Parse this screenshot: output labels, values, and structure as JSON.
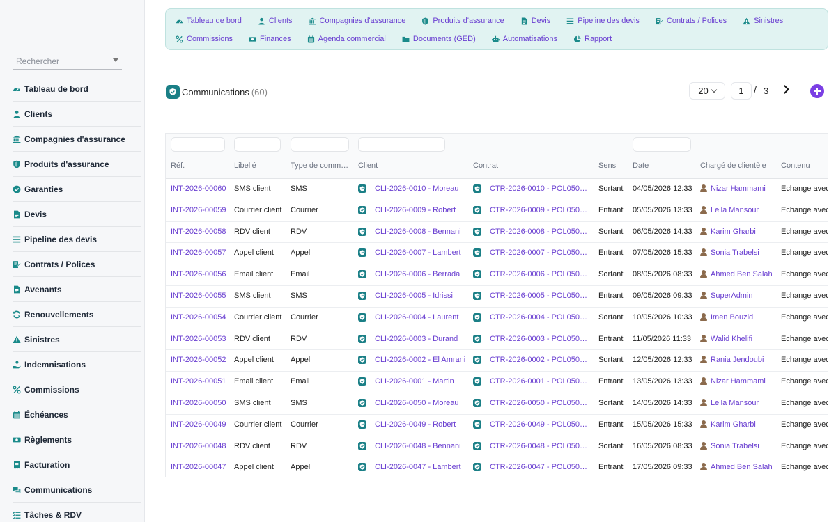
{
  "sidebar": {
    "search_placeholder": "Rechercher",
    "items": [
      {
        "label": "Tableau de bord",
        "icon": "gauge-icon"
      },
      {
        "label": "Clients",
        "icon": "user-icon"
      },
      {
        "label": "Compagnies d'assurance",
        "icon": "bank-icon"
      },
      {
        "label": "Produits d'assurance",
        "icon": "shield-icon"
      },
      {
        "label": "Garanties",
        "icon": "check-badge-icon"
      },
      {
        "label": "Devis",
        "icon": "document-icon"
      },
      {
        "label": "Pipeline des devis",
        "icon": "list-icon"
      },
      {
        "label": "Contrats / Polices",
        "icon": "contract-icon"
      },
      {
        "label": "Avenants",
        "icon": "document-icon"
      },
      {
        "label": "Renouvellements",
        "icon": "refresh-icon"
      },
      {
        "label": "Sinistres",
        "icon": "warning-icon"
      },
      {
        "label": "Indemnisations",
        "icon": "hand-coin-icon"
      },
      {
        "label": "Commissions",
        "icon": "percent-icon"
      },
      {
        "label": "Échéances",
        "icon": "calendar-icon"
      },
      {
        "label": "Règlements",
        "icon": "money-icon"
      },
      {
        "label": "Facturation",
        "icon": "invoice-icon"
      },
      {
        "label": "Communications",
        "icon": "chat-icon"
      },
      {
        "label": "Tâches & RDV",
        "icon": "tasks-icon"
      }
    ]
  },
  "topnav": {
    "row1": [
      {
        "label": "Tableau de bord",
        "icon": "gauge-icon"
      },
      {
        "label": "Clients",
        "icon": "user-icon"
      },
      {
        "label": "Compagnies d'assurance",
        "icon": "bank-icon"
      },
      {
        "label": "Produits d'assurance",
        "icon": "shield-icon"
      },
      {
        "label": "Devis",
        "icon": "document-icon"
      },
      {
        "label": "Pipeline des devis",
        "icon": "list-icon"
      },
      {
        "label": "Contrats / Polices",
        "icon": "contract-icon"
      },
      {
        "label": "Sinistres",
        "icon": "warning-icon"
      }
    ],
    "row2": [
      {
        "label": "Commissions",
        "icon": "percent-icon"
      },
      {
        "label": "Finances",
        "icon": "money-icon"
      },
      {
        "label": "Agenda commercial",
        "icon": "calendar-icon"
      },
      {
        "label": "Documents (GED)",
        "icon": "folder-icon"
      },
      {
        "label": "Automatisations",
        "icon": "robot-icon"
      },
      {
        "label": "Rapport",
        "icon": "pie-icon"
      }
    ]
  },
  "header": {
    "title": "Communications",
    "count": "(60)",
    "page_size": "20",
    "current_page": "1",
    "separator": "/",
    "total_pages": "3"
  },
  "table": {
    "columns": [
      "Réf.",
      "Libellé",
      "Type de comm…",
      "Client",
      "Contrat",
      "Sens",
      "Date",
      "Chargé de clientèle",
      "Contenu"
    ],
    "rows": [
      {
        "ref": "INT-2026-00060",
        "libelle": "SMS client",
        "type": "SMS",
        "client": "CLI-2026-0010 - Moreau",
        "contrat": "CTR-2026-0010 - POL050…",
        "sens": "Sortant",
        "date": "04/05/2026 12:33",
        "charge": "Nizar Hammami",
        "contenu": "Echange avec"
      },
      {
        "ref": "INT-2026-00059",
        "libelle": "Courrier client",
        "type": "Courrier",
        "client": "CLI-2026-0009 - Robert",
        "contrat": "CTR-2026-0009 - POL050…",
        "sens": "Entrant",
        "date": "05/05/2026 13:33",
        "charge": "Leila Mansour",
        "contenu": "Echange avec"
      },
      {
        "ref": "INT-2026-00058",
        "libelle": "RDV client",
        "type": "RDV",
        "client": "CLI-2026-0008 - Bennani",
        "contrat": "CTR-2026-0008 - POL050…",
        "sens": "Sortant",
        "date": "06/05/2026 14:33",
        "charge": "Karim Gharbi",
        "contenu": "Echange avec"
      },
      {
        "ref": "INT-2026-00057",
        "libelle": "Appel client",
        "type": "Appel",
        "client": "CLI-2026-0007 - Lambert",
        "contrat": "CTR-2026-0007 - POL050…",
        "sens": "Entrant",
        "date": "07/05/2026 15:33",
        "charge": "Sonia Trabelsi",
        "contenu": "Echange avec"
      },
      {
        "ref": "INT-2026-00056",
        "libelle": "Email client",
        "type": "Email",
        "client": "CLI-2026-0006 - Berrada",
        "contrat": "CTR-2026-0006 - POL050…",
        "sens": "Sortant",
        "date": "08/05/2026 08:33",
        "charge": "Ahmed Ben Salah",
        "contenu": "Echange avec"
      },
      {
        "ref": "INT-2026-00055",
        "libelle": "SMS client",
        "type": "SMS",
        "client": "CLI-2026-0005 - Idrissi",
        "contrat": "CTR-2026-0005 - POL050…",
        "sens": "Entrant",
        "date": "09/05/2026 09:33",
        "charge": "SuperAdmin",
        "contenu": "Echange avec"
      },
      {
        "ref": "INT-2026-00054",
        "libelle": "Courrier client",
        "type": "Courrier",
        "client": "CLI-2026-0004 - Laurent",
        "contrat": "CTR-2026-0004 - POL050…",
        "sens": "Sortant",
        "date": "10/05/2026 10:33",
        "charge": "Imen Bouzid",
        "contenu": "Echange avec"
      },
      {
        "ref": "INT-2026-00053",
        "libelle": "RDV client",
        "type": "RDV",
        "client": "CLI-2026-0003 - Durand",
        "contrat": "CTR-2026-0003 - POL050…",
        "sens": "Entrant",
        "date": "11/05/2026 11:33",
        "charge": "Walid Khelifi",
        "contenu": "Echange avec"
      },
      {
        "ref": "INT-2026-00052",
        "libelle": "Appel client",
        "type": "Appel",
        "client": "CLI-2026-0002 - El Amrani",
        "contrat": "CTR-2026-0002 - POL050…",
        "sens": "Sortant",
        "date": "12/05/2026 12:33",
        "charge": "Rania Jendoubi",
        "contenu": "Echange avec"
      },
      {
        "ref": "INT-2026-00051",
        "libelle": "Email client",
        "type": "Email",
        "client": "CLI-2026-0001 - Martin",
        "contrat": "CTR-2026-0001 - POL050…",
        "sens": "Entrant",
        "date": "13/05/2026 13:33",
        "charge": "Nizar Hammami",
        "contenu": "Echange avec"
      },
      {
        "ref": "INT-2026-00050",
        "libelle": "SMS client",
        "type": "SMS",
        "client": "CLI-2026-0050 - Moreau",
        "contrat": "CTR-2026-0050 - POL050…",
        "sens": "Sortant",
        "date": "14/05/2026 14:33",
        "charge": "Leila Mansour",
        "contenu": "Echange avec"
      },
      {
        "ref": "INT-2026-00049",
        "libelle": "Courrier client",
        "type": "Courrier",
        "client": "CLI-2026-0049 - Robert",
        "contrat": "CTR-2026-0049 - POL050…",
        "sens": "Entrant",
        "date": "15/05/2026 15:33",
        "charge": "Karim Gharbi",
        "contenu": "Echange avec"
      },
      {
        "ref": "INT-2026-00048",
        "libelle": "RDV client",
        "type": "RDV",
        "client": "CLI-2026-0048 - Bennani",
        "contrat": "CTR-2026-0048 - POL050…",
        "sens": "Sortant",
        "date": "16/05/2026 08:33",
        "charge": "Sonia Trabelsi",
        "contenu": "Echange avec"
      },
      {
        "ref": "INT-2026-00047",
        "libelle": "Appel client",
        "type": "Appel",
        "client": "CLI-2026-0047 - Lambert",
        "contrat": "CTR-2026-0047 - POL050…",
        "sens": "Entrant",
        "date": "17/05/2026 09:33",
        "charge": "Ahmed Ben Salah",
        "contenu": "Echange avec"
      }
    ]
  },
  "colors": {
    "accent": "#6a3fd1",
    "brand_teal": "#1a7f86",
    "nav_bg": "#e1f3f2",
    "add_button": "#7b3fe4"
  }
}
